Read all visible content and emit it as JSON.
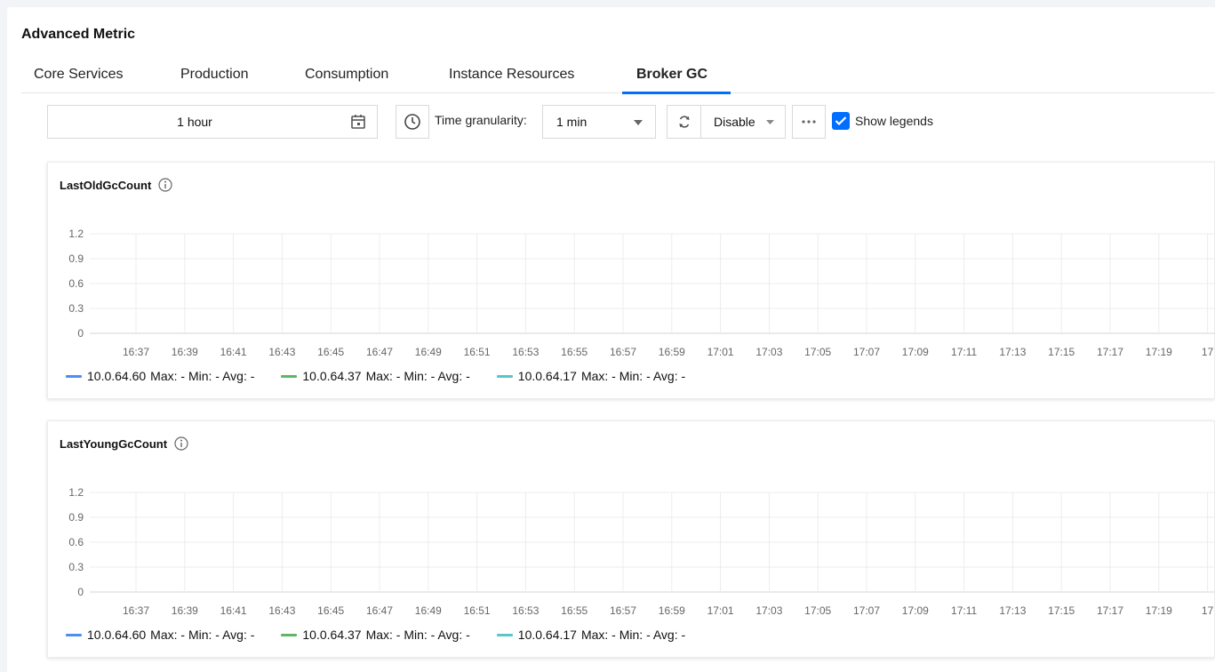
{
  "page": {
    "title": "Advanced Metric"
  },
  "tabs": [
    {
      "label": "Core Services",
      "active": false
    },
    {
      "label": "Production",
      "active": false
    },
    {
      "label": "Consumption",
      "active": false
    },
    {
      "label": "Instance Resources",
      "active": false
    },
    {
      "label": "Broker GC",
      "active": true
    }
  ],
  "toolbar": {
    "time_range": "1 hour",
    "granularity_label": "Time granularity:",
    "granularity_value": "1 min",
    "refresh_value": "Disable",
    "show_legends_label": "Show legends",
    "show_legends_checked": true
  },
  "colors": {
    "accent": "#006eff",
    "series": [
      "#4a8ff6",
      "#5fb565",
      "#55c7c9"
    ]
  },
  "charts": [
    {
      "title": "LastOldGcCount",
      "legend": [
        {
          "name": "10.0.64.60",
          "stats": "Max: - Min: - Avg: -"
        },
        {
          "name": "10.0.64.37",
          "stats": "Max: - Min: - Avg: -"
        },
        {
          "name": "10.0.64.17",
          "stats": "Max: - Min: - Avg: -"
        }
      ]
    },
    {
      "title": "LastYoungGcCount",
      "legend": [
        {
          "name": "10.0.64.60",
          "stats": "Max: - Min: - Avg: -"
        },
        {
          "name": "10.0.64.37",
          "stats": "Max: - Min: - Avg: -"
        },
        {
          "name": "10.0.64.17",
          "stats": "Max: - Min: - Avg: -"
        }
      ]
    }
  ],
  "chart_data": [
    {
      "type": "line",
      "title": "LastOldGcCount",
      "x": [
        "16:37",
        "16:39",
        "16:41",
        "16:43",
        "16:45",
        "16:47",
        "16:49",
        "16:51",
        "16:53",
        "16:55",
        "16:57",
        "16:59",
        "17:01",
        "17:03",
        "17:05",
        "17:07",
        "17:09",
        "17:11",
        "17:13",
        "17:15",
        "17:17",
        "17:19",
        "17"
      ],
      "yticks": [
        "0",
        "0.3",
        "0.6",
        "0.9",
        "1.2"
      ],
      "ylim": [
        0,
        1.2
      ],
      "grid": true,
      "series": [
        {
          "name": "10.0.64.60",
          "values": []
        },
        {
          "name": "10.0.64.37",
          "values": []
        },
        {
          "name": "10.0.64.17",
          "values": []
        }
      ]
    },
    {
      "type": "line",
      "title": "LastYoungGcCount",
      "x": [
        "16:37",
        "16:39",
        "16:41",
        "16:43",
        "16:45",
        "16:47",
        "16:49",
        "16:51",
        "16:53",
        "16:55",
        "16:57",
        "16:59",
        "17:01",
        "17:03",
        "17:05",
        "17:07",
        "17:09",
        "17:11",
        "17:13",
        "17:15",
        "17:17",
        "17:19",
        "17"
      ],
      "yticks": [
        "0",
        "0.3",
        "0.6",
        "0.9",
        "1.2"
      ],
      "ylim": [
        0,
        1.2
      ],
      "grid": true,
      "series": [
        {
          "name": "10.0.64.60",
          "values": []
        },
        {
          "name": "10.0.64.37",
          "values": []
        },
        {
          "name": "10.0.64.17",
          "values": []
        }
      ]
    }
  ]
}
